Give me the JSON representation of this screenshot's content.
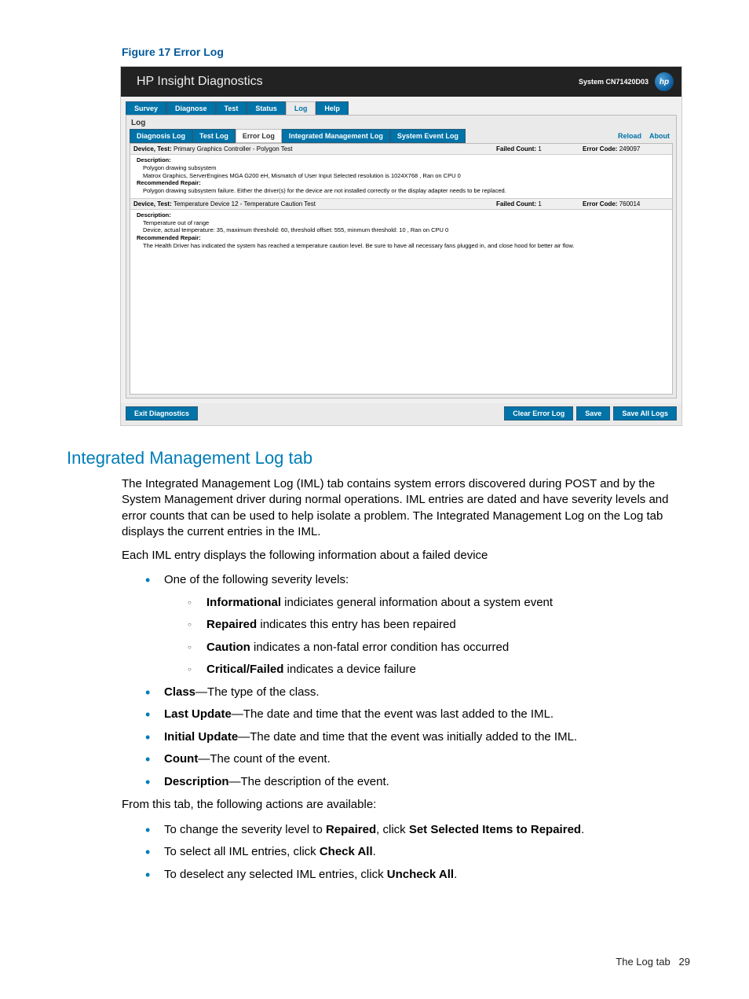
{
  "figure_caption": "Figure 17 Error Log",
  "screenshot": {
    "title": "HP Insight Diagnostics",
    "system": "System CN71420D03",
    "logo_text": "hp",
    "main_tabs": [
      "Survey",
      "Diagnose",
      "Test",
      "Status",
      "Log",
      "Help"
    ],
    "active_main_tab": "Log",
    "panel_label": "Log",
    "sub_tabs": [
      "Diagnosis Log",
      "Test Log",
      "Error Log",
      "Integrated Management Log",
      "System Event Log"
    ],
    "active_sub_tab": "Error Log",
    "links": {
      "reload": "Reload",
      "about": "About"
    },
    "entries": [
      {
        "device_test_label": "Device, Test:",
        "device_test": "Primary Graphics Controller - Polygon Test",
        "failed_label": "Failed Count:",
        "failed": "1",
        "error_label": "Error Code:",
        "error": "249097",
        "desc_label": "Description:",
        "desc_line1": "Polygon drawing subsystem",
        "desc_line2": "Matrox Graphics, ServerEngines MGA G200 eH, Mismatch of User Input Selected resolution is 1024X768 , Ran on CPU 0",
        "repair_label": "Recommended Repair:",
        "repair": "Polygon drawing subsystem failure. Either the driver(s) for the device are not installed correctly or the display adapter needs to be replaced."
      },
      {
        "device_test_label": "Device, Test:",
        "device_test": "Temperature Device 12 - Temperature Caution Test",
        "failed_label": "Failed Count:",
        "failed": "1",
        "error_label": "Error Code:",
        "error": "760014",
        "desc_label": "Description:",
        "desc_line1": "Temperature out of range",
        "desc_line2": "Device, actual temperature: 35, maximum threshold: 60, threshold offset: 555, minmum threshold: 10 , Ran on CPU 0",
        "repair_label": "Recommended Repair:",
        "repair": "The Health Driver has indicated the system has reached a temperature caution level. Be sure to have all necessary fans plugged in, and close hood for better air flow."
      }
    ],
    "buttons": {
      "exit": "Exit Diagnostics",
      "clear": "Clear Error Log",
      "save": "Save",
      "save_all": "Save All Logs"
    }
  },
  "section_heading": "Integrated Management Log tab",
  "para1": "The Integrated Management Log (IML) tab contains system errors discovered during POST and by the System Management driver during normal operations. IML entries are dated and have severity levels and error counts that can be used to help isolate a problem. The Integrated Management Log on the Log tab displays the current entries in the IML.",
  "para2": "Each IML entry displays the following information about a failed device",
  "list_intro": "One of the following severity levels:",
  "severity": [
    {
      "b": "Informational",
      "t": " indiciates general information about a system event"
    },
    {
      "b": "Repaired",
      "t": " indicates this entry has been repaired"
    },
    {
      "b": "Caution",
      "t": " indicates a non-fatal error condition has occurred"
    },
    {
      "b": "Critical/Failed",
      "t": " indicates a device failure"
    }
  ],
  "fields": [
    {
      "b": "Class",
      "t": "—The type of the class."
    },
    {
      "b": "Last Update",
      "t": "—The date and time that the event was last added to the IML."
    },
    {
      "b": "Initial Update",
      "t": "—The date and time that the event was initially added to the IML."
    },
    {
      "b": "Count",
      "t": "—The count of the event."
    },
    {
      "b": "Description",
      "t": "—The description of the event."
    }
  ],
  "para3": "From this tab, the following actions are available:",
  "actions": [
    {
      "pre": "To change the severity level to ",
      "b1": "Repaired",
      "mid": ", click ",
      "b2": "Set Selected Items to Repaired",
      "post": "."
    },
    {
      "pre": "To select all IML entries, click ",
      "b1": "Check All",
      "mid": "",
      "b2": "",
      "post": "."
    },
    {
      "pre": "To deselect any selected IML entries, click ",
      "b1": "Uncheck All",
      "mid": "",
      "b2": "",
      "post": "."
    }
  ],
  "footer": {
    "label": "The Log tab",
    "page": "29"
  }
}
